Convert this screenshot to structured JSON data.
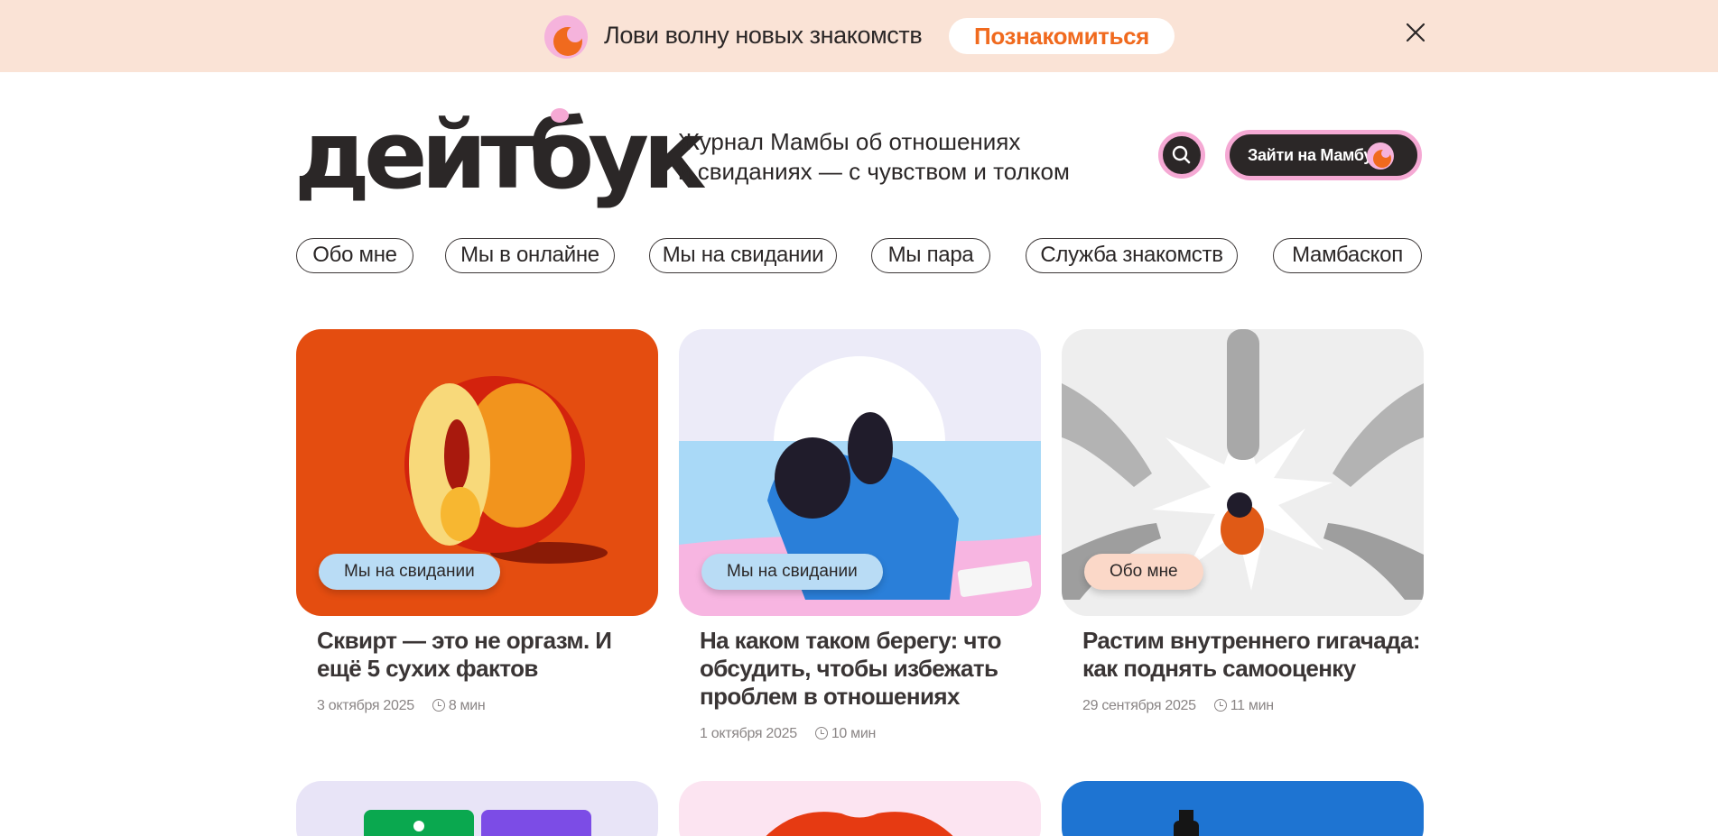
{
  "promo": {
    "text": "Лови волну новых знакомств",
    "button_label": "Познакомиться",
    "colors": {
      "background": "#fae3d6",
      "accent": "#f06a1e"
    }
  },
  "header": {
    "logo_text": "дейтбук",
    "tagline_line1": "Журнал Мамбы об отношениях",
    "tagline_line2": "и свиданиях — с чувством и толком",
    "search_icon": "search-icon",
    "login_label": "Зайти на Мамбу"
  },
  "categories": [
    "Обо мне",
    "Мы в онлайне",
    "Мы на свидании",
    "Мы пара",
    "Служба знакомств",
    "Мамбаскоп"
  ],
  "articles": [
    {
      "tag": "Мы на свидании",
      "title": "Сквирт — это не оргазм. И ещё 5 сухих фактов",
      "date": "3 октября 2025",
      "read_time": "8 мин",
      "image_color": "#e44d10",
      "tag_color": "#b9dcf5"
    },
    {
      "tag": "Мы на свидании",
      "title": "На каком таком берегу: что обсудить, чтобы избежать проблем в отношениях",
      "date": "1 октября 2025",
      "read_time": "10 мин",
      "image_color": "#ecebf8",
      "tag_color": "#b9dcf5"
    },
    {
      "tag": "Обо мне",
      "title": "Растим внутреннего гигачада: как поднять самооценку",
      "date": "29 сентября 2025",
      "read_time": "11 мин",
      "image_color": "#eeeeee",
      "tag_color": "#fbd8c8"
    }
  ]
}
